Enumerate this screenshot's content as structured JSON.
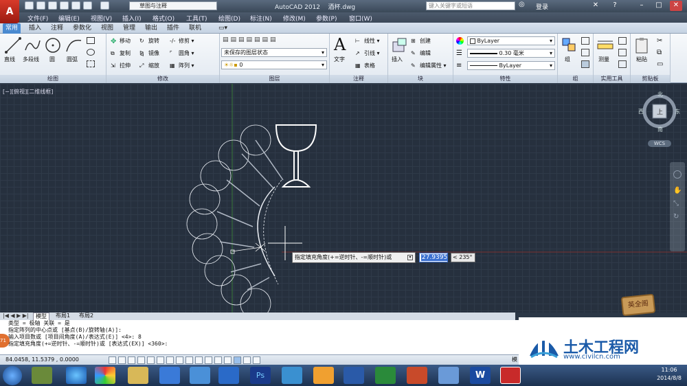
{
  "window": {
    "title": "AutoCAD 2012",
    "file": "酒杯.dwg",
    "workspace": "草图与注释",
    "search_placeholder": "键入关键字或短语",
    "login": "登录"
  },
  "menu": [
    "文件(F)",
    "编辑(E)",
    "视图(V)",
    "插入(I)",
    "格式(O)",
    "工具(T)",
    "绘图(D)",
    "标注(N)",
    "修改(M)",
    "参数(P)",
    "窗口(W)"
  ],
  "tabs": [
    "常用",
    "插入",
    "注释",
    "参数化",
    "视图",
    "管理",
    "输出",
    "插件",
    "联机"
  ],
  "ribbon": {
    "draw": {
      "title": "绘图",
      "line": "直线",
      "polyline": "多段线",
      "circle": "圆",
      "arc": "圆弧"
    },
    "modify": {
      "title": "修改",
      "move": "移动",
      "rotate": "旋转",
      "trim": "修剪",
      "copy": "复制",
      "mirror": "镜像",
      "fillet": "圆角",
      "stretch": "拉伸",
      "scale": "缩放",
      "array": "阵列"
    },
    "layers": {
      "title": "图层",
      "state": "未保存的图层状态",
      "current": "0"
    },
    "annotation": {
      "title": "注释",
      "text": "文字",
      "linear": "线性",
      "leader": "引线",
      "table": "表格"
    },
    "block": {
      "title": "块",
      "insert": "插入",
      "create": "创建",
      "edit": "编辑",
      "edit_attr": "编辑属性"
    },
    "properties": {
      "title": "特性",
      "color": "ByLayer",
      "lineweight": "0.30 毫米",
      "linetype": "ByLayer"
    },
    "groups": {
      "title": "组",
      "group": "组"
    },
    "utilities": {
      "title": "实用工具",
      "measure": "测量"
    },
    "clipboard": {
      "title": "剪贴板",
      "paste": "粘贴"
    }
  },
  "viewport": {
    "label": "[−][俯视][二维线框]",
    "compass": {
      "north": "北",
      "south": "南",
      "east": "东",
      "west": "西",
      "center": "上"
    },
    "wcs": "WCS"
  },
  "dynamic_input": {
    "prompt": "指定填充角度(+=逆时针、-=顺时针)或",
    "value": "27.9395",
    "angle": "< 235°"
  },
  "layout_tabs": [
    "模型",
    "布局1",
    "布局2"
  ],
  "command_history": [
    "类型 = 极轴  关联 = 是",
    "指定阵列的中心点或 [基点(B)/旋转轴(A)]:",
    "输入项目数或 [项目间角度(A)/表达式(E)] <4>: 8",
    "指定填充角度(+=逆时针、-=顺时针)或 [表达式(EX)] <360>:"
  ],
  "status": {
    "coords": "84.0458,   11.5379 , 0.0000",
    "model": "模"
  },
  "watermark": {
    "brand": "土木工程网",
    "url": "www.civilcn.com",
    "sticker": "英全阁"
  },
  "clock": {
    "time": "11:06",
    "date": "2014/8/8"
  },
  "colors": {
    "canvas": "#26303e",
    "accent": "#4a8ad0",
    "drawing": "#ffffff"
  }
}
